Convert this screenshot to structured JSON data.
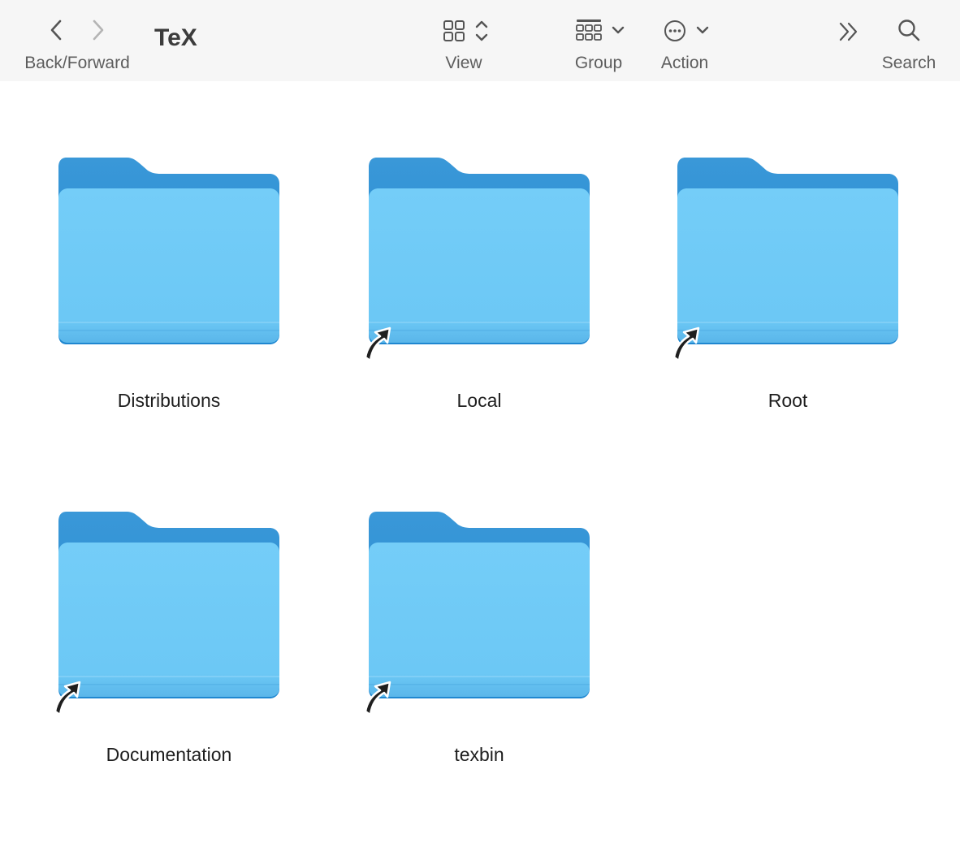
{
  "window": {
    "title": "TeX"
  },
  "toolbar": {
    "nav_label": "Back/Forward",
    "view_label": "View",
    "group_label": "Group",
    "action_label": "Action",
    "search_label": "Search",
    "icons": [
      "chevron-left-icon",
      "chevron-right-icon",
      "grid-icon",
      "sort-updown-icon",
      "group-grid-icon",
      "chevron-down-icon",
      "ellipsis-circle-icon",
      "chevron-double-right-icon",
      "magnifier-icon"
    ]
  },
  "items": [
    {
      "name": "Distributions",
      "alias": false
    },
    {
      "name": "Local",
      "alias": true
    },
    {
      "name": "Root",
      "alias": true
    },
    {
      "name": "Documentation",
      "alias": true
    },
    {
      "name": "texbin",
      "alias": true
    }
  ],
  "colors": {
    "toolbar_bg": "#f6f6f6",
    "folder_back": "#3b9ad9",
    "folder_front": "#6fcbf7",
    "folder_bottom": "#5ab6ea"
  }
}
